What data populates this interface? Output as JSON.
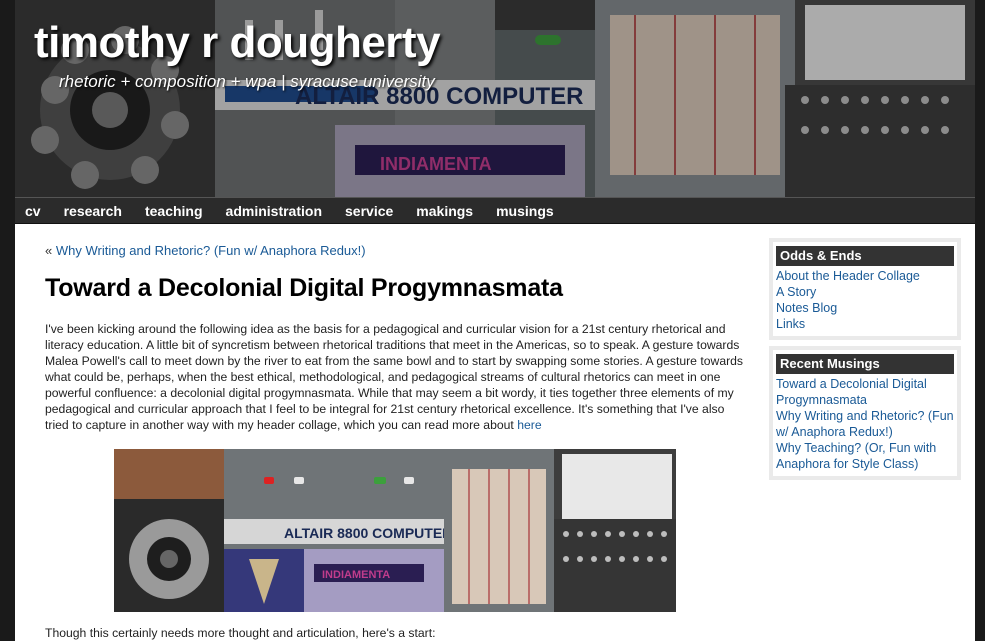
{
  "header": {
    "title": "timothy r dougherty",
    "tagline": "rhetoric + composition + wpa | syracuse university"
  },
  "nav": {
    "items": [
      "cv",
      "research",
      "teaching",
      "administration",
      "service",
      "makings",
      "musings"
    ]
  },
  "post": {
    "prev_arrow": "«",
    "prev_link": "Why Writing and Rhetoric? (Fun w/ Anaphora Redux!)",
    "title": "Toward a Decolonial Digital Progymnasmata",
    "body": "I've been kicking around the following idea as the basis for a pedagogical and curricular vision for a 21st century rhetorical and literacy education. A little bit of syncretism between rhetorical traditions that meet in the Americas, so to speak. A gesture towards Malea Powell's call to meet down by the river to eat from the same bowl and to start by swapping some stories. A gesture towards what could be, perhaps, when the best ethical, methodological, and pedagogical streams of cultural rhetorics can meet in one powerful confluence: a decolonial digital progymnasmata. While that may seem a bit wordy, it ties together three elements of my pedagogical and curricular approach that I feel to be integral for 21st century rhetorical excellence. It's something that I've also tried to capture in another way with my header collage, which you can read more about",
    "body_link": "here",
    "after_image": "Though this certainly needs more thought and articulation, here's a start:"
  },
  "collage_text": {
    "computer_label": "ALTAIR 8800 COMPUTER",
    "mural_label": "INDIAMENTA"
  },
  "sidebar": {
    "odds": {
      "heading": "Odds & Ends",
      "links": [
        "About the Header Collage",
        "A Story",
        "Notes Blog",
        "Links"
      ]
    },
    "recent": {
      "heading": "Recent Musings",
      "links": [
        "Toward a Decolonial Digital Progymnasmata",
        "Why Writing and Rhetoric? (Fun w/ Anaphora Redux!)",
        "Why Teaching? (Or, Fun with Anaphora for Style Class)"
      ]
    }
  },
  "colors": {
    "link": "#1a5a96",
    "nav_bg": "#2b2b2b",
    "widget_heading_bg": "#333333"
  }
}
